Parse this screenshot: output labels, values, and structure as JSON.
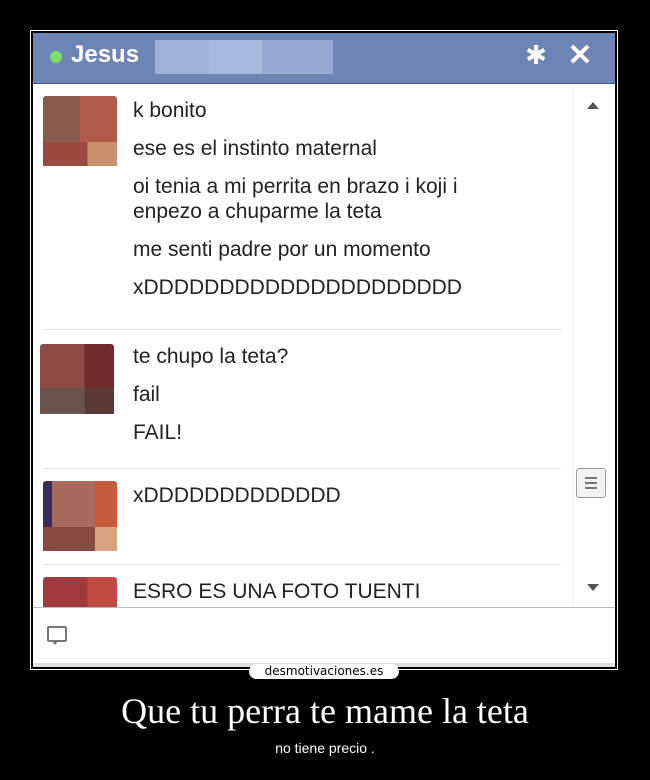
{
  "chat": {
    "contact_name": "Jesus",
    "messages": [
      {
        "lines": [
          "k bonito",
          "ese es el instinto maternal",
          "oi tenia a mi perrita en brazo i koji i enpezo a chuparme la teta",
          "me senti padre por un momento",
          "xDDDDDDDDDDDDDDDDDDDDD"
        ]
      },
      {
        "lines": [
          "te chupo la teta?",
          "fail",
          "FAIL!"
        ]
      },
      {
        "lines": [
          "xDDDDDDDDDDDDD"
        ]
      },
      {
        "lines": [
          "ESRO ES UNA FOTO TUENTI"
        ]
      }
    ]
  },
  "icons": {
    "gear": "gear-icon",
    "close": "close-icon",
    "scroll_up": "scroll-up-arrow-icon",
    "scroll_down": "scroll-down-arrow-icon",
    "chat_input": "chat-bubble-icon"
  },
  "colors": {
    "titlebar": "#6d84b4",
    "online": "#7fdc6a",
    "background": "#000000"
  },
  "watermark": "desmotivaciones.es",
  "caption": {
    "title": "Que tu perra te mame la teta",
    "subtitle": "no tiene precio ."
  }
}
